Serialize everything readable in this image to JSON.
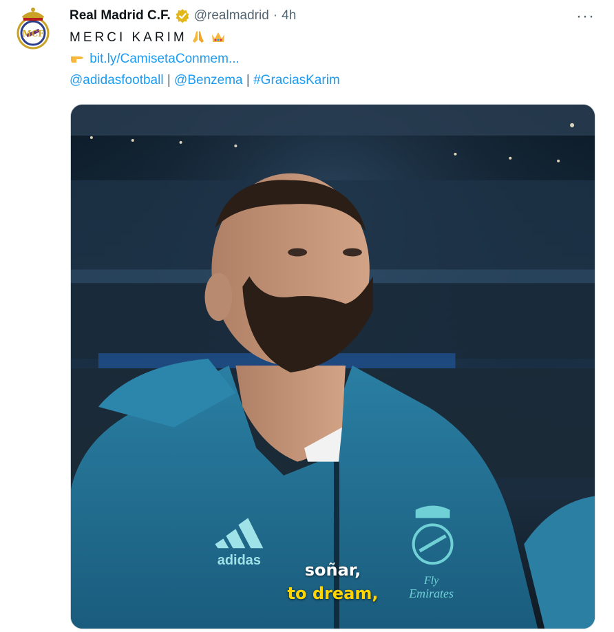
{
  "account": {
    "display_name": "Real Madrid C.F.",
    "handle": "@realmadrid",
    "separator": "·",
    "time": "4h",
    "avatar_icon": "real-madrid-crest-icon",
    "verified_icon": "gold-verified-badge-icon"
  },
  "tweet": {
    "line1": "MERCI KARIM",
    "line1_emoji": [
      "folded-hands-emoji",
      "crown-emoji"
    ],
    "line2_emoji": "pointing-right-emoji",
    "link_text": "bit.ly/CamisetaConmem...",
    "mentions": [
      {
        "text": "@adidasfootball"
      },
      {
        "text": "@Benzema"
      },
      {
        "text": "#GraciasKarim"
      }
    ],
    "mention_separator": "|"
  },
  "media": {
    "type": "video",
    "subtitle_es": "soñar,",
    "subtitle_en": "to dream,",
    "jacket_brand": "adidas",
    "jacket_sponsor_line1": "Fly",
    "jacket_sponsor_line2": "Emirates"
  },
  "menu": {
    "more_label": "···"
  },
  "colors": {
    "link": "#1d9bf0",
    "muted": "#536471",
    "verified": "#e2b719",
    "subtitle_en": "#ffd400"
  }
}
